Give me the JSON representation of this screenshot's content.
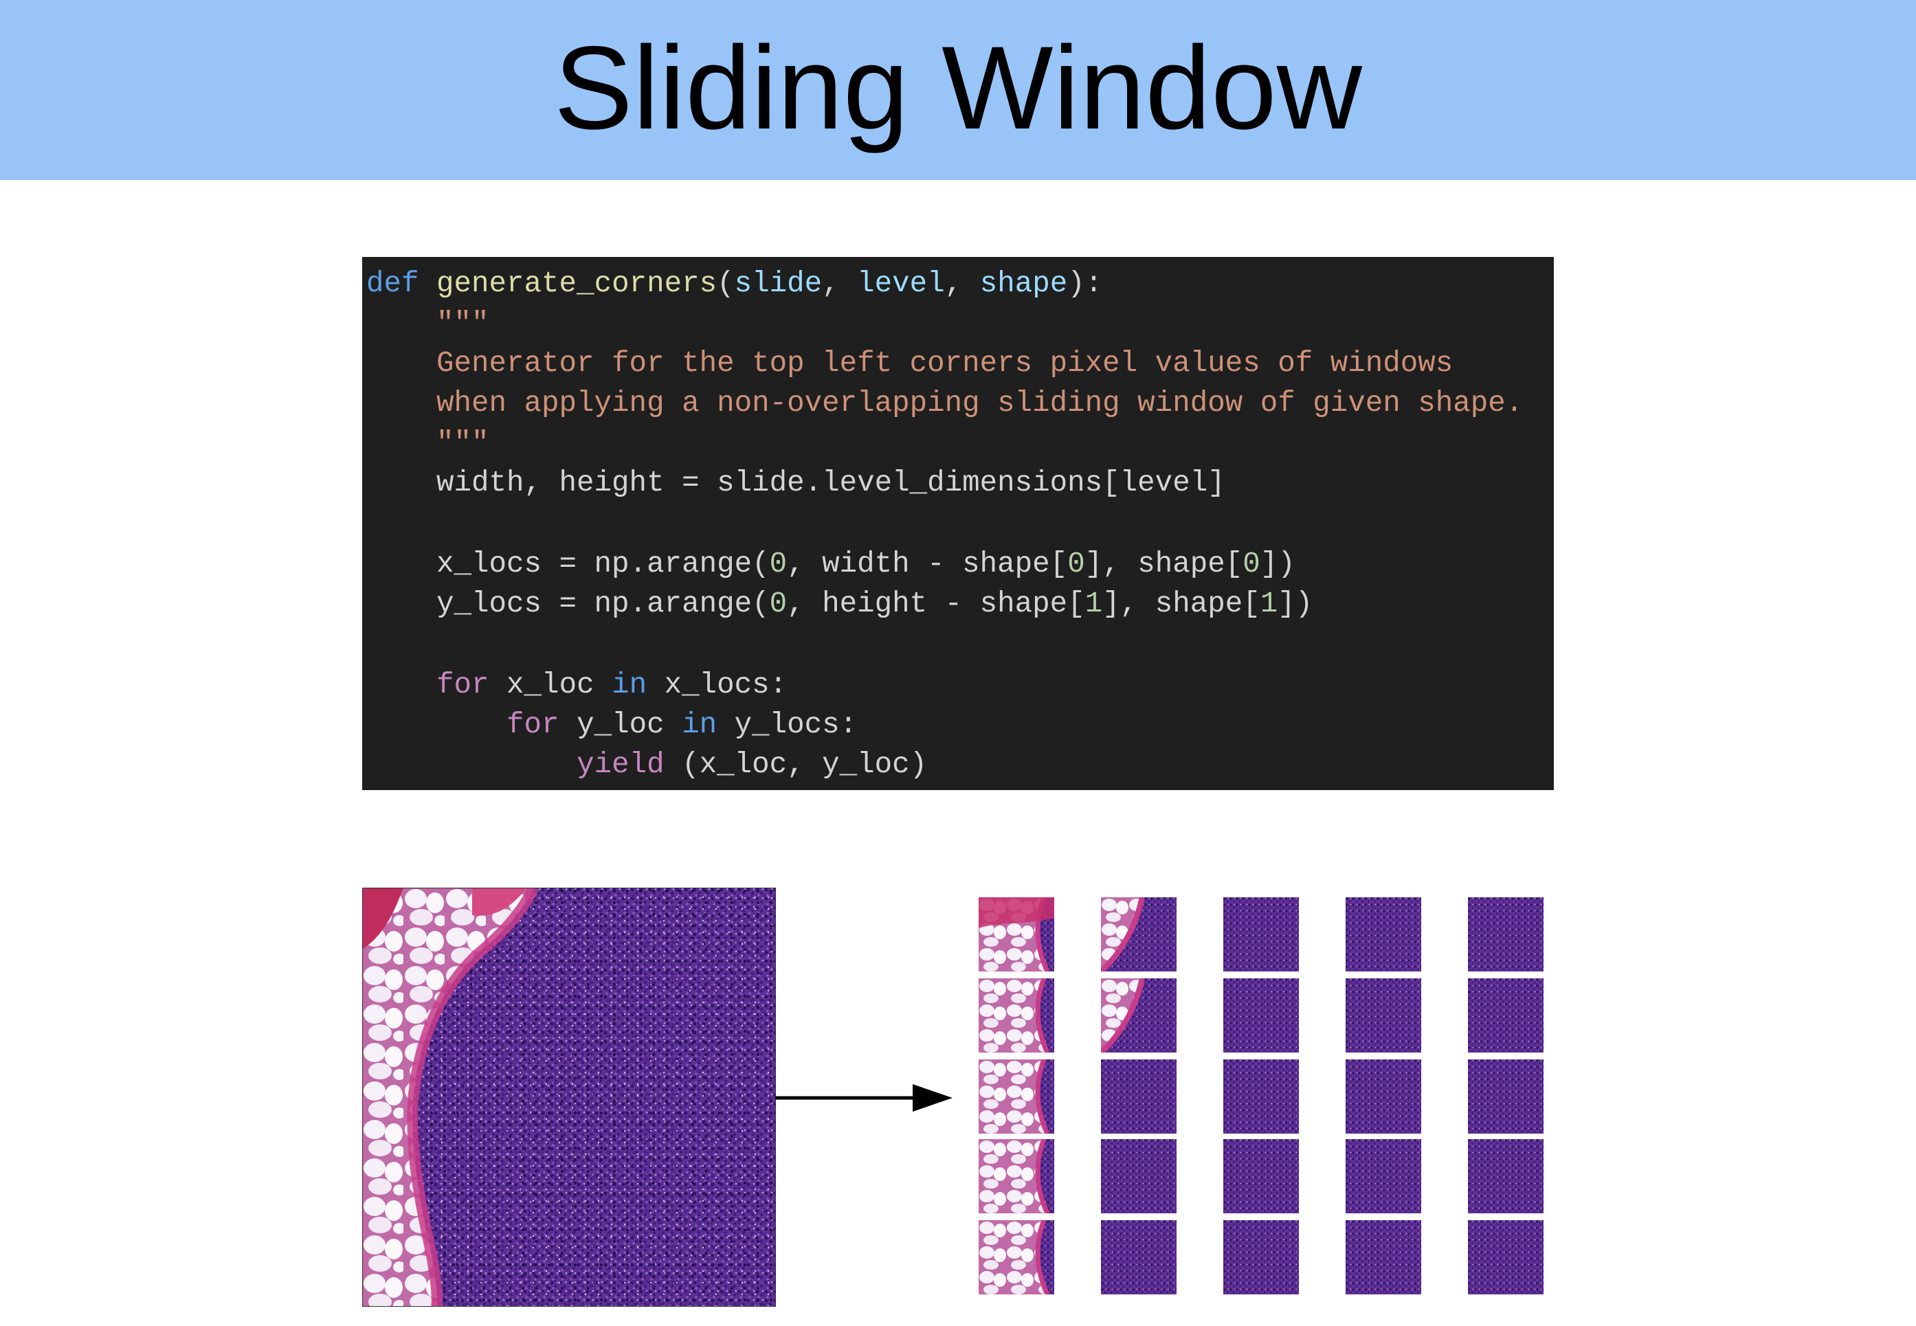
{
  "title": "Sliding Window",
  "code": {
    "language": "python",
    "lines": [
      {
        "tokens": [
          {
            "t": "def",
            "c": "def"
          },
          {
            "t": " ",
            "c": "plain"
          },
          {
            "t": "generate_corners",
            "c": "fn"
          },
          {
            "t": "(",
            "c": "plain"
          },
          {
            "t": "slide",
            "c": "param"
          },
          {
            "t": ", ",
            "c": "plain"
          },
          {
            "t": "level",
            "c": "param"
          },
          {
            "t": ", ",
            "c": "plain"
          },
          {
            "t": "shape",
            "c": "param"
          },
          {
            "t": "):",
            "c": "plain"
          }
        ]
      },
      {
        "tokens": [
          {
            "t": "    \"\"\"",
            "c": "str"
          }
        ]
      },
      {
        "tokens": [
          {
            "t": "    Generator for the top left corners pixel values of windows",
            "c": "str"
          }
        ]
      },
      {
        "tokens": [
          {
            "t": "    when applying a non-overlapping sliding window of given shape.",
            "c": "str"
          }
        ]
      },
      {
        "tokens": [
          {
            "t": "    \"\"\"",
            "c": "str"
          }
        ]
      },
      {
        "tokens": [
          {
            "t": "    width, height = slide.level_dimensions[level]",
            "c": "plain"
          }
        ]
      },
      {
        "tokens": []
      },
      {
        "tokens": [
          {
            "t": "    x_locs = np.arange(",
            "c": "plain"
          },
          {
            "t": "0",
            "c": "num"
          },
          {
            "t": ", width - shape[",
            "c": "plain"
          },
          {
            "t": "0",
            "c": "num"
          },
          {
            "t": "], shape[",
            "c": "plain"
          },
          {
            "t": "0",
            "c": "num"
          },
          {
            "t": "])",
            "c": "plain"
          }
        ]
      },
      {
        "tokens": [
          {
            "t": "    y_locs = np.arange(",
            "c": "plain"
          },
          {
            "t": "0",
            "c": "num"
          },
          {
            "t": ", height - shape[",
            "c": "plain"
          },
          {
            "t": "1",
            "c": "num"
          },
          {
            "t": "], shape[",
            "c": "plain"
          },
          {
            "t": "1",
            "c": "num"
          },
          {
            "t": "])",
            "c": "plain"
          }
        ]
      },
      {
        "tokens": []
      },
      {
        "tokens": [
          {
            "t": "    ",
            "c": "plain"
          },
          {
            "t": "for",
            "c": "ctl"
          },
          {
            "t": " x_loc ",
            "c": "plain"
          },
          {
            "t": "in",
            "c": "in"
          },
          {
            "t": " x_locs:",
            "c": "plain"
          }
        ]
      },
      {
        "tokens": [
          {
            "t": "        ",
            "c": "plain"
          },
          {
            "t": "for",
            "c": "ctl"
          },
          {
            "t": " y_loc ",
            "c": "plain"
          },
          {
            "t": "in",
            "c": "in"
          },
          {
            "t": " y_locs:",
            "c": "plain"
          }
        ]
      },
      {
        "tokens": [
          {
            "t": "            ",
            "c": "plain"
          },
          {
            "t": "yield",
            "c": "ctl"
          },
          {
            "t": " (x_loc, y_loc)",
            "c": "plain"
          }
        ]
      }
    ]
  },
  "tiles": {
    "rows": 5,
    "cols": 5
  },
  "colors": {
    "title_bar": "#98c4f8",
    "code_background": "#1f1f1f",
    "tissue_purple": "#6a3a9e",
    "tissue_pink": "#c84a8a",
    "fat_white": "#f4eef8"
  }
}
